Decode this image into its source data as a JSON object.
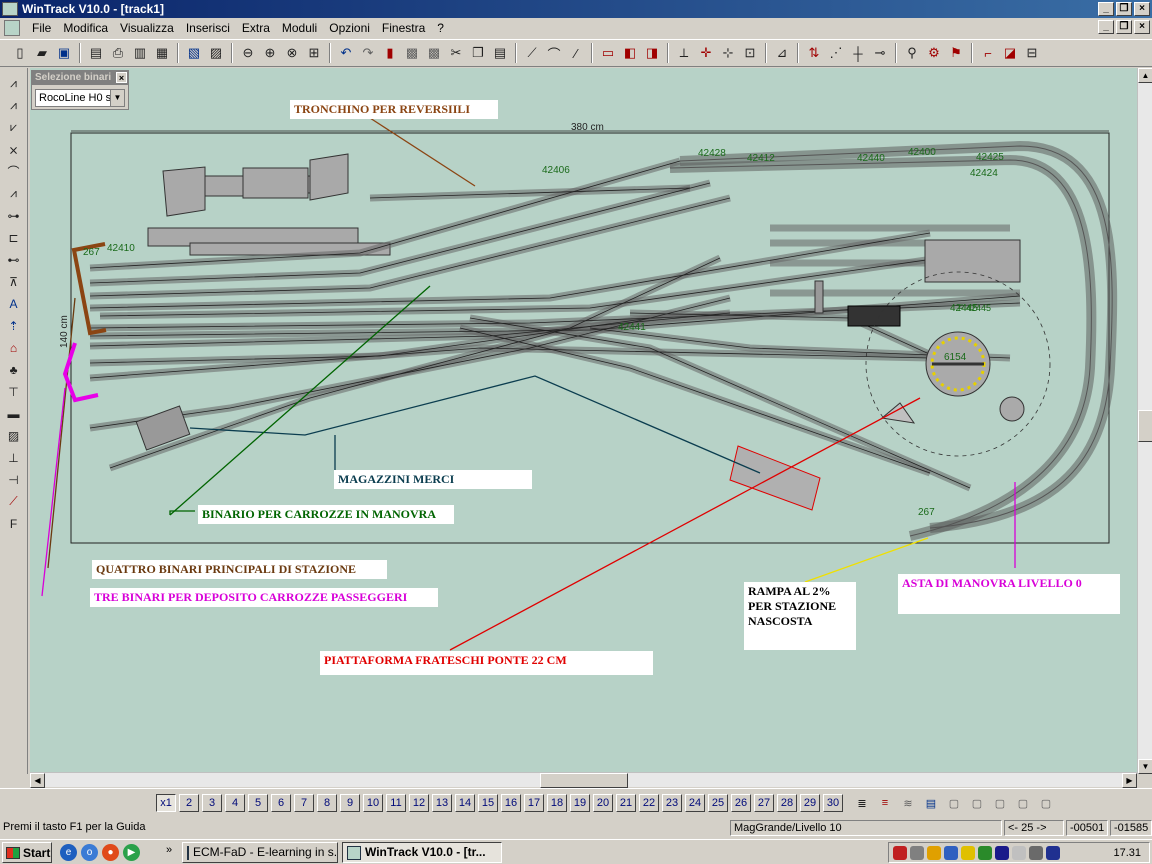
{
  "window": {
    "title": "WinTrack  V10.0 - [track1]",
    "buttons": [
      "_",
      "❐",
      "×"
    ]
  },
  "menu": {
    "items": [
      "File",
      "Modifica",
      "Visualizza",
      "Inserisci",
      "Extra",
      "Moduli",
      "Opzioni",
      "Finestra",
      "?"
    ]
  },
  "toolbar": {
    "groups": [
      [
        "new-file-icon",
        "open-folder-icon",
        "save-icon"
      ],
      [
        "print-preview-icon",
        "print-icon",
        "print-setup-icon",
        "parts-list-icon"
      ],
      [
        "library-icon",
        "picture-icon"
      ],
      [
        "zoom-out-icon",
        "zoom-in-icon",
        "zoom-window-icon",
        "zoom-fit-icon"
      ],
      [
        "undo-icon",
        "redo-icon",
        "delete-icon",
        "copy-layer-icon",
        "paste-layer-icon",
        "cut-icon",
        "copy-icon",
        "paste-icon"
      ],
      [
        "flex-track-icon",
        "curve-icon",
        "straight-track-icon"
      ],
      [
        "select-box-icon",
        "select-red-icon",
        "select-multi-icon"
      ],
      [
        "measure-icon",
        "crosshair-icon",
        "connect-icon",
        "align-icon"
      ],
      [
        "insert-icon"
      ],
      [
        "height-icon",
        "gradient-icon",
        "grid-icon",
        "snap-icon"
      ],
      [
        "search-icon",
        "settings-icon",
        "properties-icon"
      ],
      [
        "text-tool-icon",
        "color-icon",
        "extra-icon"
      ]
    ]
  },
  "left_tools": [
    "select-track-icon",
    "track-list-icon",
    "turnout-icon",
    "crossing-icon",
    "curve-tool-icon",
    "rail-icon",
    "signal-icon",
    "buffer-icon",
    "track-set-icon",
    "bridge-icon",
    "text-icon",
    "height-tool-icon",
    "building-icon",
    "tree-icon",
    "catenary-icon",
    "platform-icon",
    "graph-icon",
    "gap-icon",
    "connector-icon",
    "slope-icon",
    "label-icon"
  ],
  "palette": {
    "title": "Selezione binari",
    "selected": "RocoLine H0 se"
  },
  "drawing": {
    "dimension_width": "380 cm",
    "dimension_height": "140 cm",
    "turntable_label": "6154",
    "track_codes": [
      "267",
      "42410",
      "42406",
      "42428",
      "42412",
      "42441",
      "42440",
      "42400",
      "42425",
      "42424",
      "42445",
      "267"
    ],
    "turntable_items": [
      "F 42445"
    ]
  },
  "annotations": [
    {
      "id": "tronchino",
      "text": "TRONCHINO PER REVERSIILI",
      "color": "#8b4513"
    },
    {
      "id": "magazzini",
      "text": "MAGAZZINI MERCI",
      "color": "#0b3d4f"
    },
    {
      "id": "carrozze-manovra",
      "text": "BINARIO PER CARROZZE IN MANOVRA",
      "color": "#006400"
    },
    {
      "id": "quattro-binari",
      "text": "QUATTRO BINARI PRINCIPALI DI STAZIONE",
      "color": "#6b3a10"
    },
    {
      "id": "tre-binari",
      "text": "TRE BINARI PER DEPOSITO CARROZZE PASSEGGERI",
      "color": "#d800d8"
    },
    {
      "id": "rampa",
      "text": "RAMPA AL 2%\nPER STAZIONE\nNASCOSTA",
      "color": "#000000"
    },
    {
      "id": "asta",
      "text": "ASTA DI MANOVRA LIVELLO 0",
      "color": "#d800d8"
    },
    {
      "id": "piattaforma",
      "text": "PIATTAFORMA FRATESCHI PONTE 22 CM",
      "color": "#e00000"
    }
  ],
  "levels": {
    "labels": [
      "x1",
      "2",
      "3",
      "4",
      "5",
      "6",
      "7",
      "8",
      "9",
      "10",
      "11",
      "12",
      "13",
      "14",
      "15",
      "16",
      "17",
      "18",
      "19",
      "20",
      "21",
      "22",
      "23",
      "24",
      "25",
      "26",
      "27",
      "28",
      "29",
      "30"
    ],
    "active_index": 0
  },
  "status": {
    "help": "Premi il tasto F1 per la Guida",
    "layer": "MagGrande/Livello 10",
    "zoom": "<- 25 ->",
    "x": "-00501",
    "y": "-01585"
  },
  "taskbar": {
    "start": "Start",
    "tasks": [
      {
        "label": "ECM-FaD - E-learning in s...",
        "active": false
      },
      {
        "label": "WinTrack  V10.0 - [tr...",
        "active": true
      }
    ],
    "clock": "17.31"
  }
}
